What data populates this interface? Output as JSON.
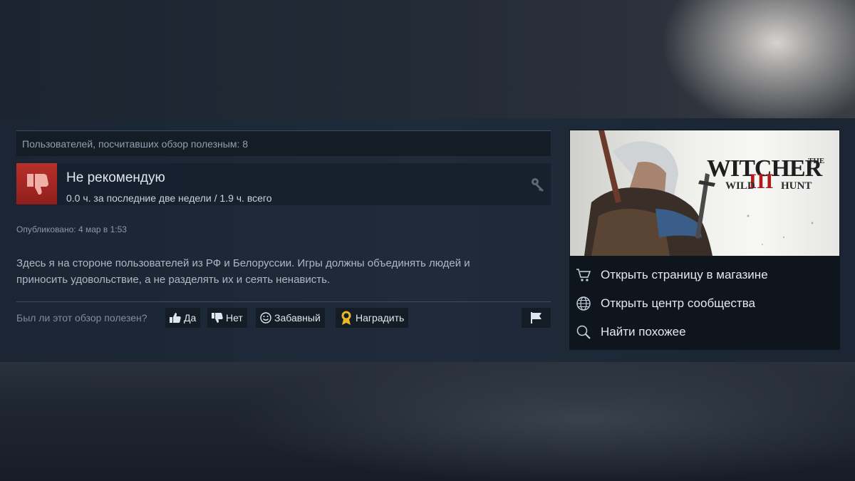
{
  "helpful_summary": "Пользователей, посчитавших обзор полезным: 8",
  "review": {
    "verdict": "Не рекомендую",
    "hours": "0.0 ч. за последние две недели / 1.9 ч. всего",
    "posted": "Опубликовано: 4 мар в 1:53",
    "text_line1": "Здесь я на стороне пользователей из РФ и Белоруссии. Игры должны объединять людей и",
    "text_line2": "приносить удовольствие, а не разделять их и сеять ненависть."
  },
  "voting": {
    "question": "Был ли этот обзор полезен?",
    "yes": "Да",
    "no": "Нет",
    "funny": "Забавный",
    "award": "Наградить"
  },
  "game": {
    "logo_the": "THE",
    "logo_main": "WITCHER",
    "logo_wild": "WILD",
    "logo_hunt": "HUNT",
    "logo_numeral": "III"
  },
  "links": [
    {
      "label": "Открыть страницу в магазине",
      "icon": "cart-icon"
    },
    {
      "label": "Открыть центр сообщества",
      "icon": "globe-icon"
    },
    {
      "label": "Найти похожее",
      "icon": "search-icon"
    }
  ],
  "colors": {
    "negative": "#a4281f",
    "panel": "#1f2b3b",
    "award": "#e8b923"
  }
}
